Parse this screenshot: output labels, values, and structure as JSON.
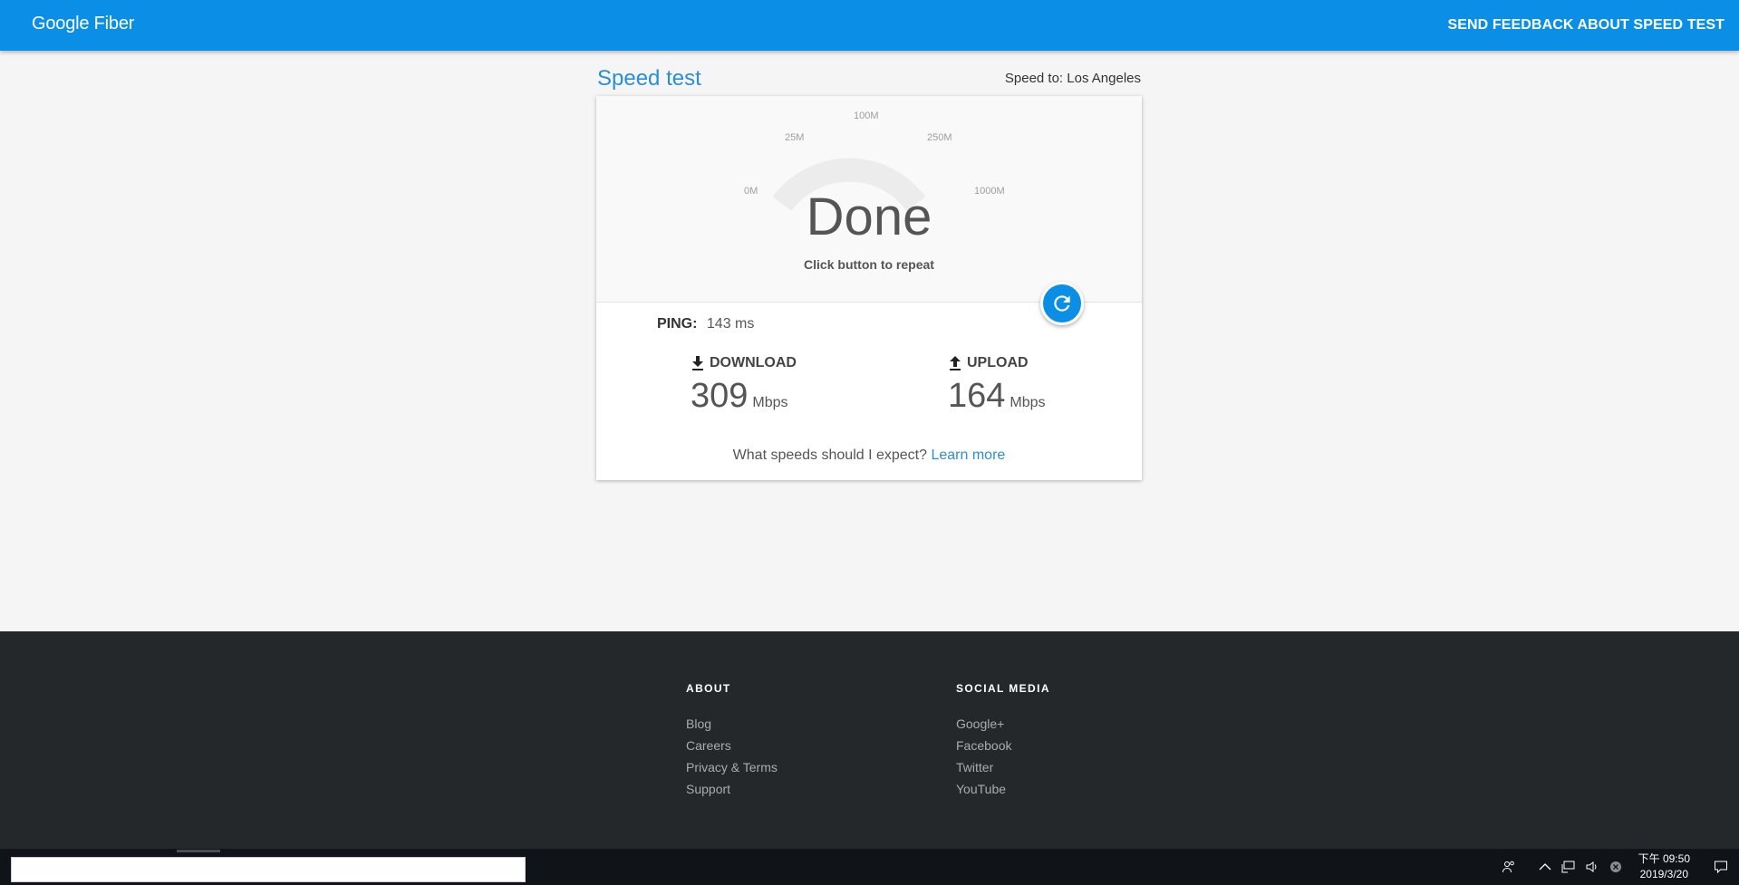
{
  "header": {
    "logo_text": "Google Fiber",
    "feedback_label": "SEND FEEDBACK ABOUT SPEED TEST",
    "bar_color": "#0b8fe6"
  },
  "main": {
    "title": "Speed test",
    "server": "Speed to: Los Angeles",
    "gauge": {
      "ticks": [
        "0M",
        "25M",
        "100M",
        "250M",
        "1000M"
      ],
      "status": "Done",
      "hint": "Click button to repeat"
    },
    "ping": {
      "label": "PING:",
      "value": "143 ms"
    },
    "download": {
      "label": "DOWNLOAD",
      "value": "309",
      "unit": "Mbps",
      "icon": "download-icon"
    },
    "upload": {
      "label": "UPLOAD",
      "value": "164",
      "unit": "Mbps",
      "icon": "upload-icon"
    },
    "expect": {
      "question": "What speeds should I expect?",
      "link": "Learn more"
    }
  },
  "footer": {
    "about": {
      "heading": "ABOUT",
      "links": [
        "Blog",
        "Careers",
        "Privacy & Terms",
        "Support"
      ]
    },
    "social": {
      "heading": "SOCIAL MEDIA",
      "links": [
        "Google+",
        "Facebook",
        "Twitter",
        "YouTube"
      ]
    }
  },
  "taskbar": {
    "time": "下午 09:50",
    "date": "2019/3/20",
    "tray_icons": [
      "people-icon",
      "chevron-up-icon",
      "network-icon",
      "volume-icon",
      "status-x-icon"
    ]
  }
}
